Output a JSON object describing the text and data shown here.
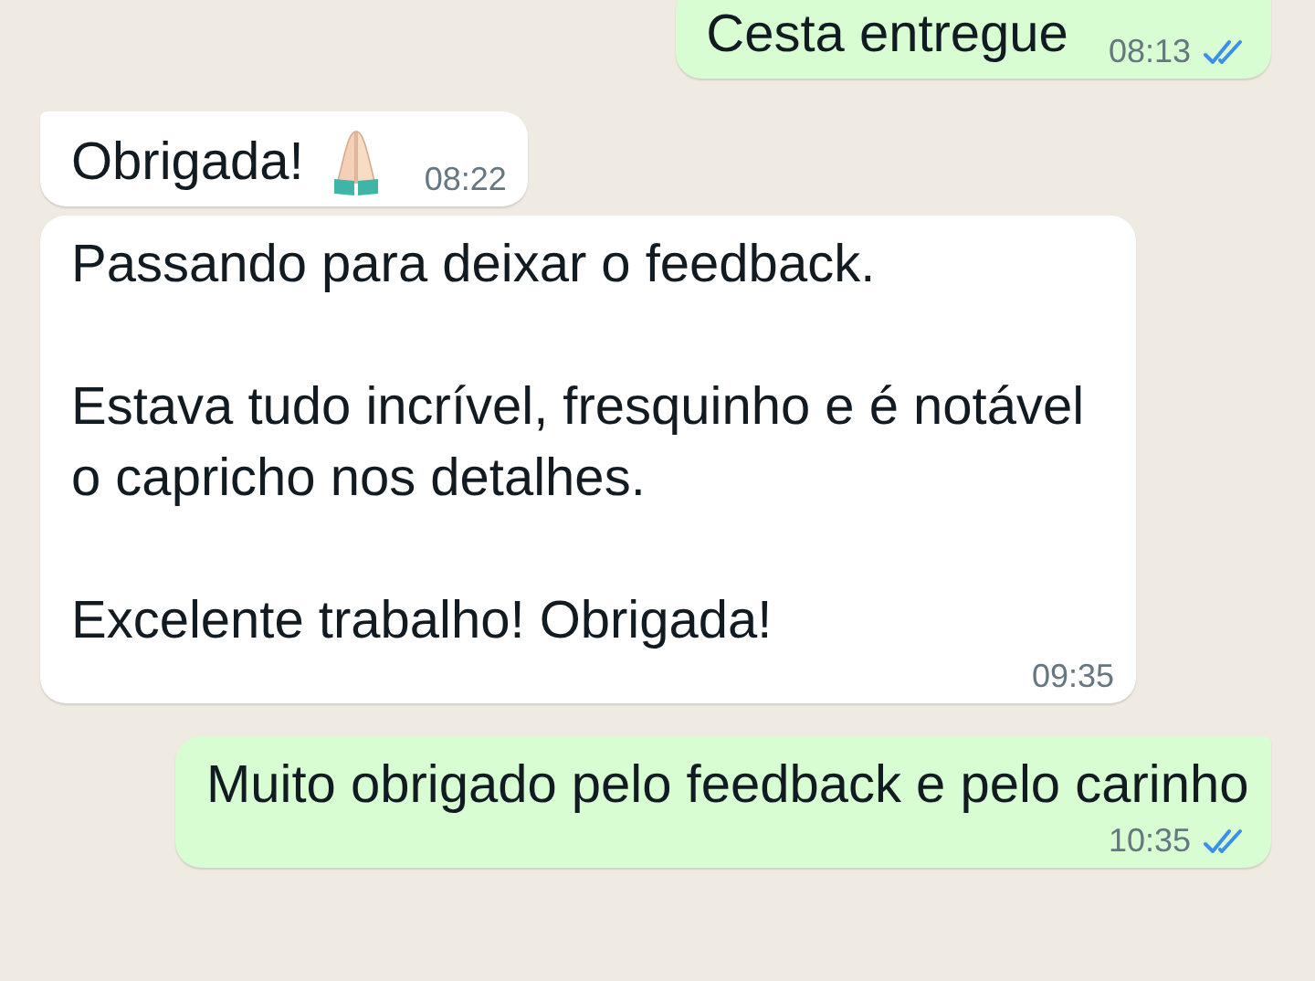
{
  "messages": [
    {
      "outgoing": true,
      "text": "Cesta entregue",
      "time": "08:13",
      "read": true,
      "emoji": false,
      "first_of_group": true
    },
    {
      "outgoing": false,
      "text": "Obrigada!",
      "time": "08:22",
      "emoji": true,
      "first_of_group": true
    },
    {
      "outgoing": false,
      "text": "Passando para deixar o feedback.\n\nEstava tudo incrível, fresquinho e é notável o capricho nos detalhes.\n\nExcelente trabalho! Obrigada!",
      "time": "09:35",
      "emoji": false,
      "first_of_group": false
    },
    {
      "outgoing": true,
      "text": "Muito obrigado pelo feedback e pelo carinho",
      "time": "10:35",
      "read": true,
      "emoji": false,
      "first_of_group": true
    }
  ]
}
